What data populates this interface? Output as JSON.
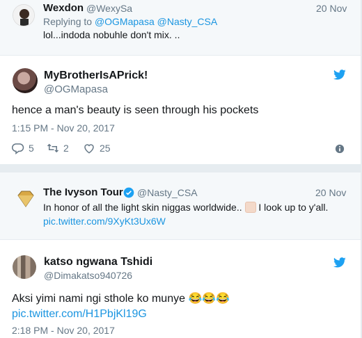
{
  "reply1": {
    "name": "Wexdon",
    "handle": "@WexySa",
    "date": "20 Nov",
    "replying_prefix": "Replying to",
    "replying_to_1": "@OGMapasa",
    "replying_to_2": "@Nasty_CSA",
    "text": "lol...indoda nobuhle don't mix. .."
  },
  "main_tweet": {
    "name": "MyBrotherIsAPrick!",
    "handle": "@OGMapasa",
    "text": "hence a man's beauty is seen through his pockets",
    "timestamp": "1:15 PM - Nov 20, 2017",
    "reply_count": "5",
    "retweet_count": "2",
    "like_count": "25"
  },
  "quoted": {
    "name": "The Ivyson Tour",
    "handle": "@Nasty_CSA",
    "date": "20 Nov",
    "text_before": "In honor of all the light skin niggas worldwide..",
    "text_after": "I look up to y'all.",
    "link": "pic.twitter.com/9XyKt3Ux6W"
  },
  "last_tweet": {
    "name": "katso ngwana Tshidi",
    "handle": "@Dimakatso940726",
    "text": "Aksi yimi nami ngi sthole ko munye",
    "emoji": "😂😂😂",
    "link": "pic.twitter.com/H1PbjKl19G",
    "timestamp": "2:18 PM - Nov 20, 2017"
  },
  "colors": {
    "twitter_blue": "#1da1f2",
    "link_blue": "#1b95e0",
    "muted": "#657786",
    "background": "#e6ecf0"
  },
  "icons": [
    "reply-icon",
    "retweet-icon",
    "like-icon",
    "info-icon",
    "twitter-bird-icon",
    "verified-badge-icon",
    "raised-fist-emoji"
  ]
}
